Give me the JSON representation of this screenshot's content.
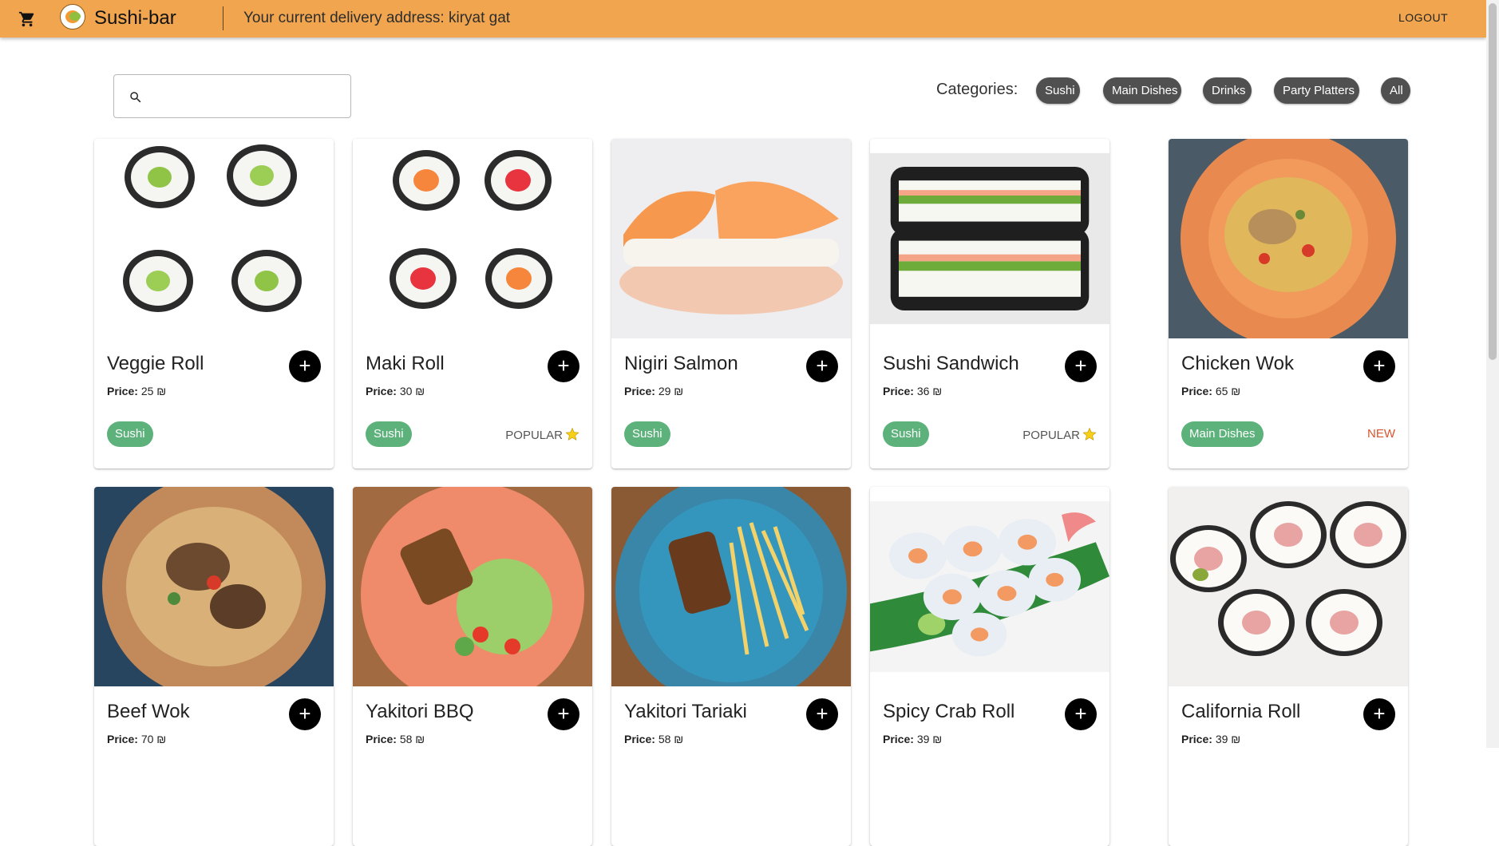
{
  "header": {
    "brand": "Sushi-bar",
    "address": "Your current delivery address: kiryat gat",
    "logout": "LOGOUT"
  },
  "search": {
    "placeholder": "",
    "value": ""
  },
  "categories": {
    "label": "Categories:",
    "items": [
      "Sushi",
      "Main Dishes",
      "Drinks",
      "Party Platters",
      "All"
    ]
  },
  "price_label": "Price:",
  "currency": "₪",
  "products": [
    {
      "name": "Veggie Roll",
      "price": "25",
      "category": "Sushi",
      "badge": ""
    },
    {
      "name": "Maki Roll",
      "price": "30",
      "category": "Sushi",
      "badge": "POPULAR"
    },
    {
      "name": "Nigiri Salmon",
      "price": "29",
      "category": "Sushi",
      "badge": ""
    },
    {
      "name": "Sushi Sandwich",
      "price": "36",
      "category": "Sushi",
      "badge": "POPULAR"
    },
    {
      "name": "Chicken Wok",
      "price": "65",
      "category": "Main Dishes",
      "badge": "NEW"
    },
    {
      "name": "Beef Wok",
      "price": "70",
      "category": "",
      "badge": ""
    },
    {
      "name": "Yakitori BBQ",
      "price": "58",
      "category": "",
      "badge": ""
    },
    {
      "name": "Yakitori Tariaki",
      "price": "58",
      "category": "",
      "badge": ""
    },
    {
      "name": "Spicy Crab Roll",
      "price": "39",
      "category": "",
      "badge": ""
    },
    {
      "name": "California Roll",
      "price": "39",
      "category": "",
      "badge": ""
    }
  ],
  "colors": {
    "header": "#f0a54e",
    "chip": "#505050",
    "tag": "#5cb27a",
    "new": "#d9552e",
    "add_button": "#000000"
  }
}
